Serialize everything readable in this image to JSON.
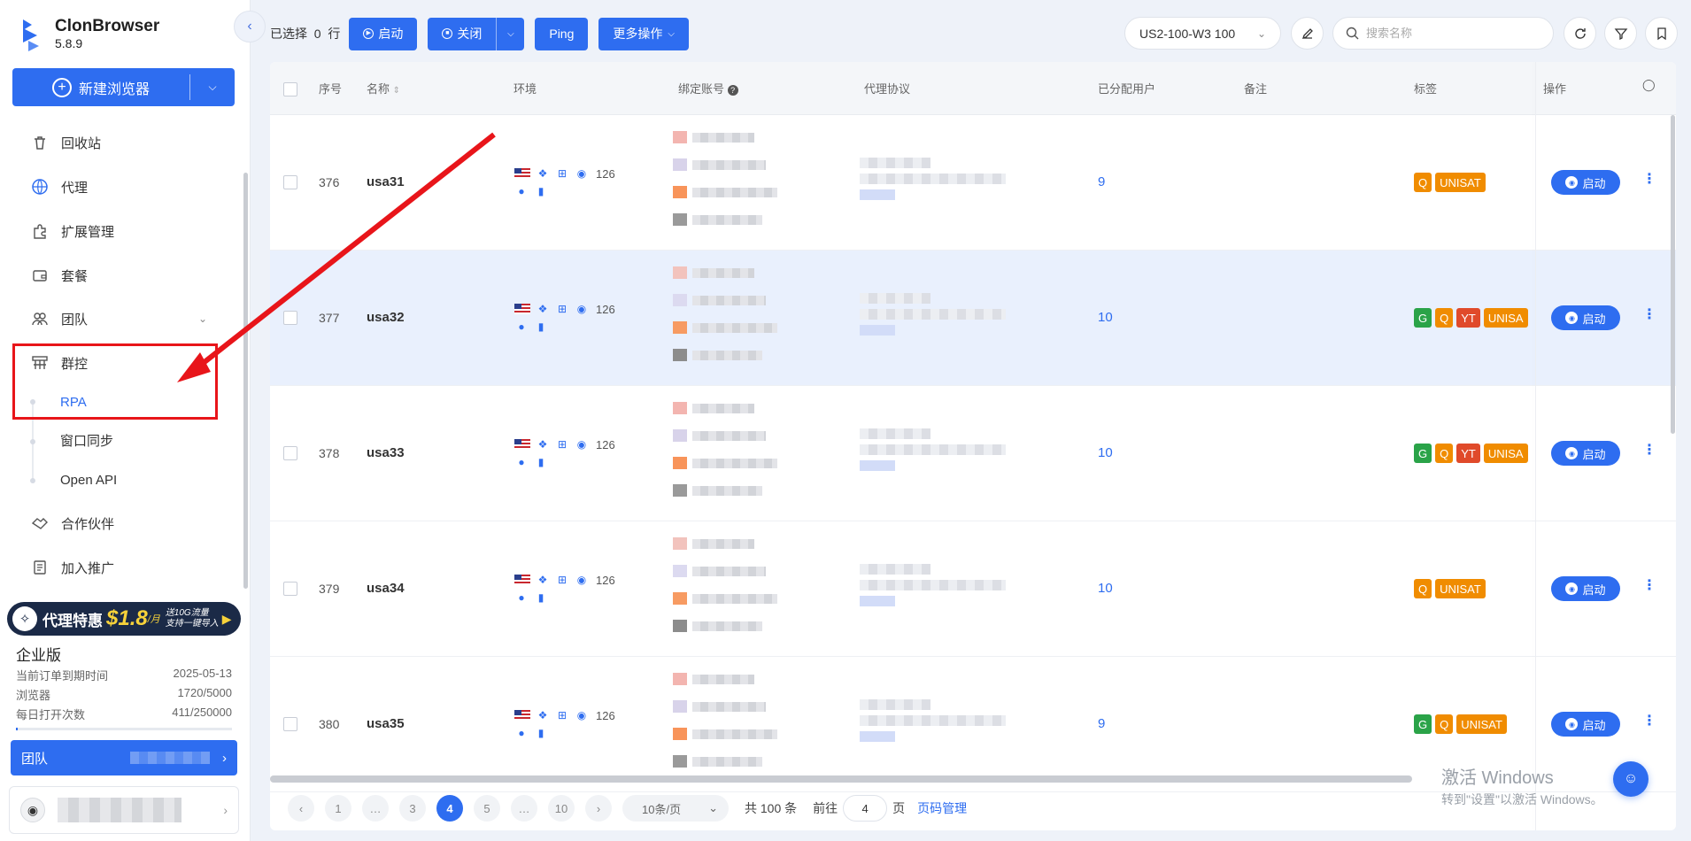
{
  "app": {
    "name": "ClonBrowser",
    "version": "5.8.9"
  },
  "sidebar": {
    "new_browser_label": "新建浏览器",
    "items": [
      {
        "label": "回收站",
        "icon": "trash-icon"
      },
      {
        "label": "代理",
        "icon": "globe-icon"
      },
      {
        "label": "扩展管理",
        "icon": "puzzle-icon"
      },
      {
        "label": "套餐",
        "icon": "wallet-icon"
      },
      {
        "label": "团队",
        "icon": "team-icon"
      },
      {
        "label": "群控",
        "icon": "group-control-icon"
      },
      {
        "label": "合作伙伴",
        "icon": "handshake-icon"
      },
      {
        "label": "加入推广",
        "icon": "promote-icon"
      }
    ],
    "sub_items": [
      "RPA",
      "窗口同步",
      "Open API"
    ],
    "promo": {
      "text": "代理特惠",
      "price": "$1.8",
      "unit": "/月",
      "sub1": "送10G流量",
      "sub2": "支持一键导入"
    },
    "plan": {
      "title": "企业版",
      "rows": [
        {
          "label": "当前订单到期时间",
          "value": "2025-05-13"
        },
        {
          "label": "浏览器",
          "value": "1720/5000"
        },
        {
          "label": "每日打开次数",
          "value": "411/250000"
        }
      ],
      "usage_fraction": 0.01
    },
    "team_label": "团队"
  },
  "toolbar": {
    "selected_prefix": "已选择",
    "selected_count": "0",
    "selected_suffix": "行",
    "start_label": "启动",
    "close_label": "关闭",
    "ping_label": "Ping",
    "more_label": "更多操作",
    "region": "US2-100-W3 100",
    "search_placeholder": "搜索名称"
  },
  "table": {
    "headers": {
      "seq": "序号",
      "name": "名称",
      "env": "环境",
      "account": "绑定账号",
      "proxy": "代理协议",
      "users": "已分配用户",
      "remark": "备注",
      "tags": "标签",
      "ops": "操作"
    },
    "launch_label": "启动",
    "rows": [
      {
        "seq": "376",
        "name": "usa31",
        "env_count": "126",
        "users": "9",
        "tags": [
          "Q",
          "UNISAT"
        ]
      },
      {
        "seq": "377",
        "name": "usa32",
        "env_count": "126",
        "users": "10",
        "tags": [
          "G",
          "Q",
          "YT",
          "UNISA"
        ]
      },
      {
        "seq": "378",
        "name": "usa33",
        "env_count": "126",
        "users": "10",
        "tags": [
          "G",
          "Q",
          "YT",
          "UNISA"
        ]
      },
      {
        "seq": "379",
        "name": "usa34",
        "env_count": "126",
        "users": "10",
        "tags": [
          "Q",
          "UNISAT"
        ]
      },
      {
        "seq": "380",
        "name": "usa35",
        "env_count": "126",
        "users": "9",
        "tags": [
          "G",
          "Q",
          "UNISAT"
        ]
      }
    ]
  },
  "pagination": {
    "pages": [
      "1",
      "…",
      "3",
      "4",
      "5",
      "…",
      "10"
    ],
    "current": "4",
    "page_size": "10条/页",
    "total": "共 100 条",
    "goto_prefix": "前往",
    "goto_value": "4",
    "goto_suffix": "页",
    "manage_label": "页码管理"
  },
  "watermark": {
    "line1": "激活 Windows",
    "line2": "转到\"设置\"以激活 Windows。"
  },
  "colors": {
    "primary": "#2e6df0",
    "highlight": "#e8151a",
    "tag_green": "#2aa348",
    "tag_orange": "#f08c00",
    "tag_red": "#e04a2a"
  }
}
